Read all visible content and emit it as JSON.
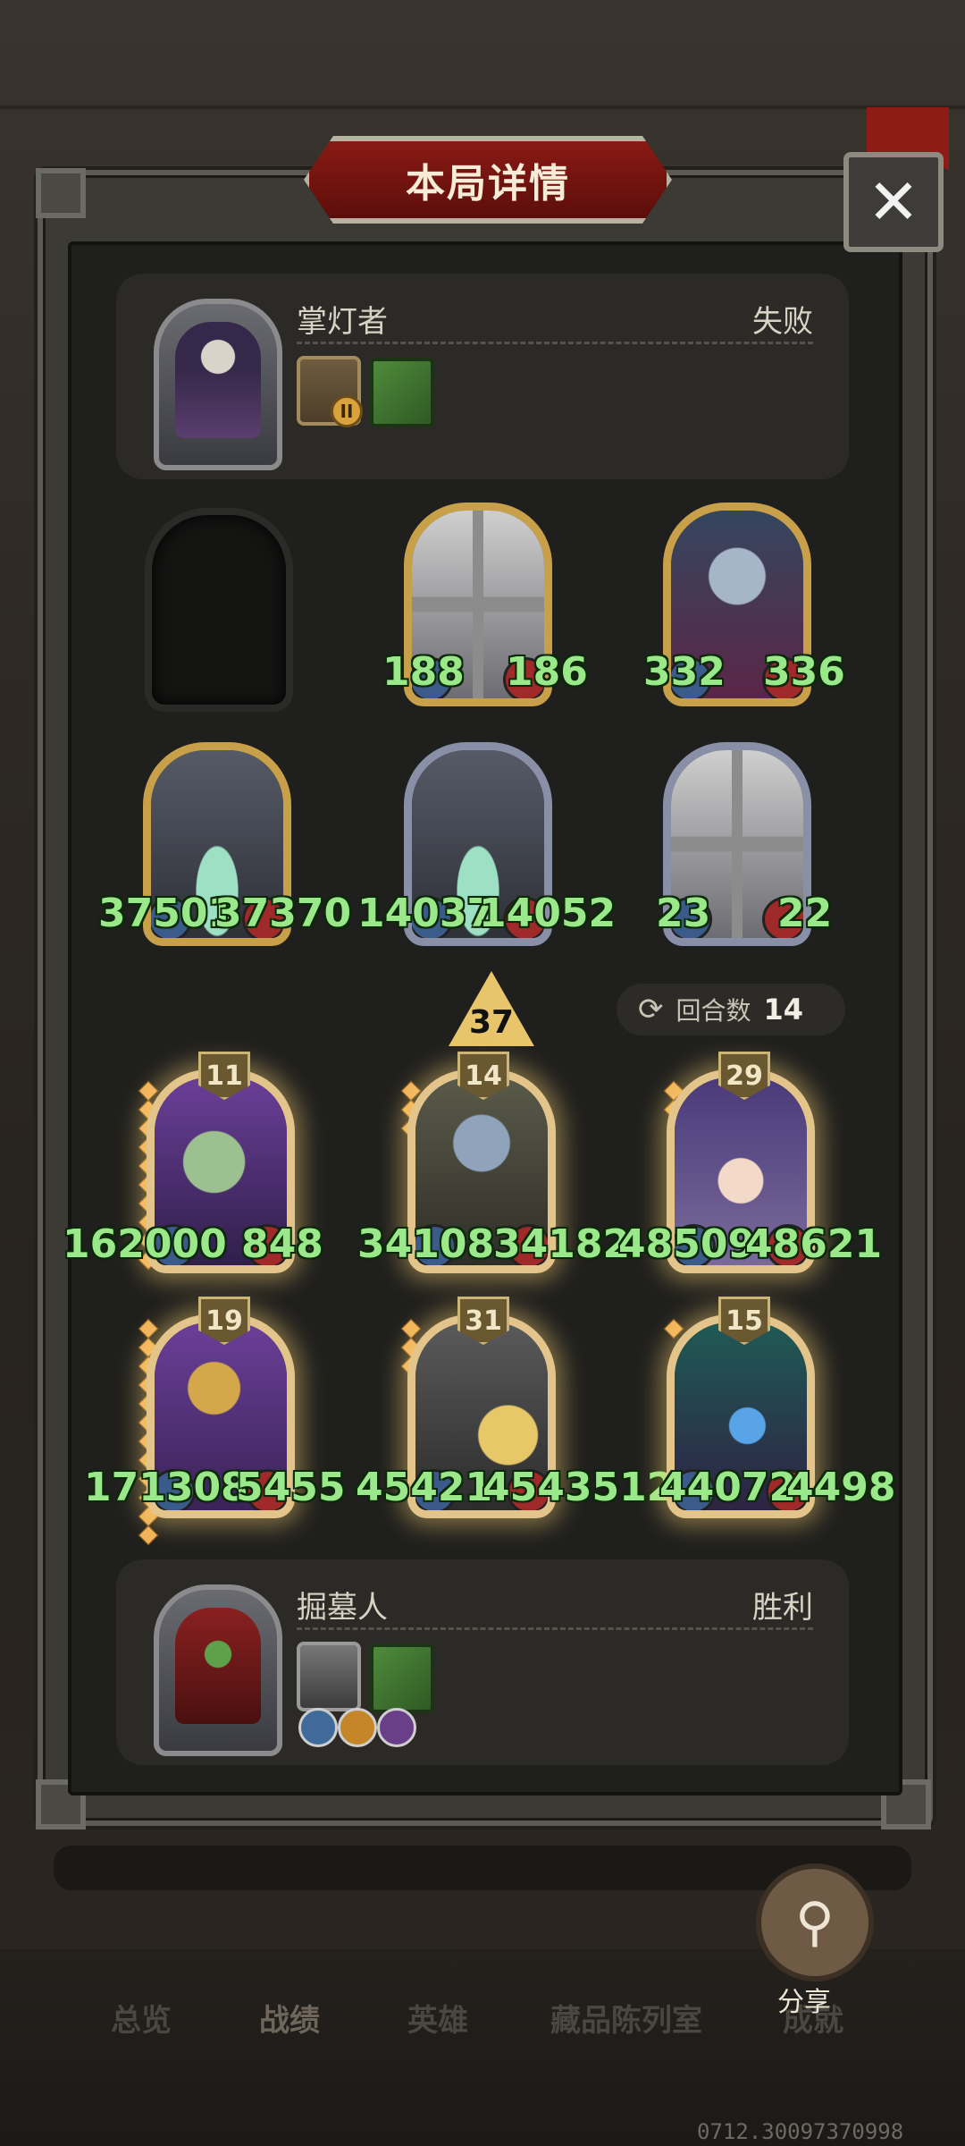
{
  "dialog": {
    "title": "本局详情",
    "close_label": "✕"
  },
  "opponent": {
    "name": "掌灯者",
    "result": "失败",
    "card_badge": "II"
  },
  "player": {
    "name": "掘墓人",
    "result": "胜利"
  },
  "opponent_board": [
    {
      "slot": 1,
      "empty": true
    },
    {
      "slot": 2,
      "attack": "188",
      "health": "186",
      "art": "windmill",
      "frame": "gold"
    },
    {
      "slot": 3,
      "attack": "332",
      "health": "336",
      "art": "elf",
      "frame": "gold"
    },
    {
      "slot": 4,
      "attack": "37501",
      "health": "37370",
      "art": "shark",
      "frame": "gold"
    },
    {
      "slot": 5,
      "attack": "14037",
      "health": "14052",
      "art": "shark",
      "frame": "silver"
    },
    {
      "slot": 6,
      "attack": "23",
      "health": "22",
      "art": "windmill",
      "frame": "silver"
    }
  ],
  "attack_indicator": "37",
  "rounds": {
    "label": "回合数",
    "value": "14"
  },
  "player_board": [
    {
      "level": "11",
      "attack": "162000",
      "health": "848",
      "art": "fish"
    },
    {
      "level": "14",
      "attack": "34108",
      "health": "34182",
      "art": "robot"
    },
    {
      "level": "29",
      "attack": "48509",
      "health": "48621",
      "art": "witch"
    },
    {
      "level": "19",
      "attack": "171308",
      "health": "5455",
      "art": "diver"
    },
    {
      "level": "31",
      "attack": "45421",
      "health": "4543512",
      "art": "knight"
    },
    {
      "level": "15",
      "attack": "44072",
      "health": "4498",
      "art": "mage"
    }
  ],
  "bottom_nav": {
    "tabs": [
      "总览",
      "战绩",
      "英雄",
      "藏品陈列室",
      "成就"
    ],
    "active": "战绩"
  },
  "share": {
    "label": "分享",
    "icon": "share-icon"
  },
  "build_id": "0712.30097370998",
  "colors": {
    "stat_text": "#9ae88a",
    "banner_red": "#8a1a14",
    "gold_frame": "#c9a04a"
  }
}
